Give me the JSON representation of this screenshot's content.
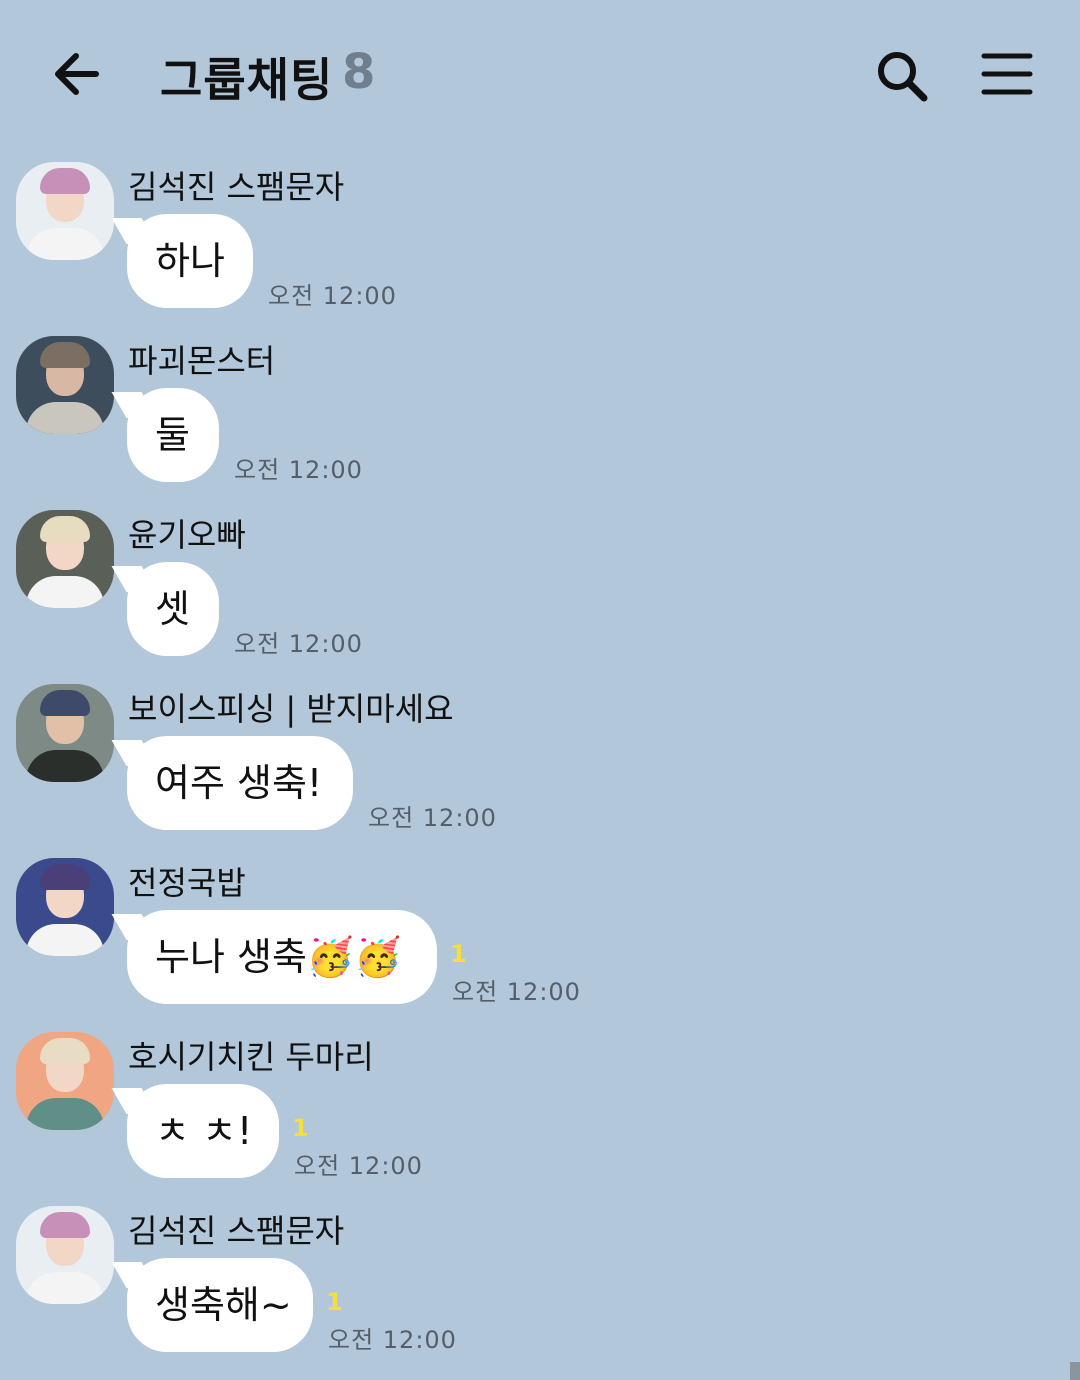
{
  "header": {
    "title": "그룹채팅",
    "member_count": "8",
    "icons": {
      "back": "arrow-left-icon",
      "search": "search-icon",
      "menu": "hamburger-menu-icon"
    }
  },
  "messages": [
    {
      "sender": "김석진 스팸문자",
      "text": "하나",
      "time": "오전 12:00",
      "unread": ""
    },
    {
      "sender": "파괴몬스터",
      "text": "둘",
      "time": "오전 12:00",
      "unread": ""
    },
    {
      "sender": "윤기오빠",
      "text": "셋",
      "time": "오전 12:00",
      "unread": ""
    },
    {
      "sender": "보이스피싱 | 받지마세요",
      "text": "여주 생축!",
      "time": "오전 12:00",
      "unread": ""
    },
    {
      "sender": "전정국밥",
      "text": "누나 생축🥳🥳",
      "time": "오전 12:00",
      "unread": "1"
    },
    {
      "sender": "호시기치킨 두마리",
      "text": "ㅊ ㅊ!",
      "time": "오전 12:00",
      "unread": "1"
    },
    {
      "sender": "김석진 스팸문자",
      "text": "생축해~",
      "time": "오전 12:00",
      "unread": "1"
    }
  ],
  "colors": {
    "background": "#b2c7da",
    "bubble": "#ffffff",
    "unread": "#f6df3c",
    "time": "#555f69"
  }
}
